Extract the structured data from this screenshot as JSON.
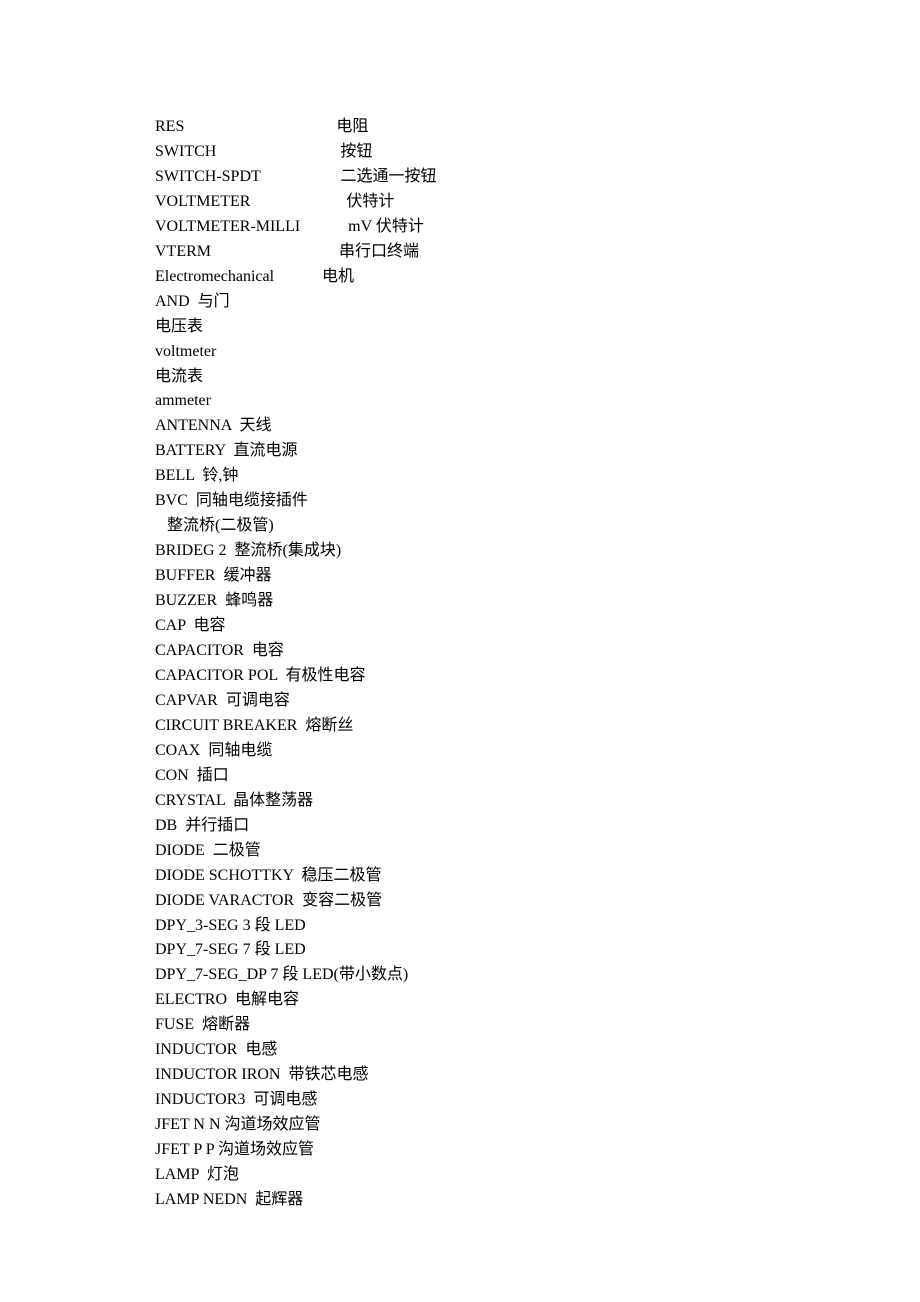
{
  "lines": [
    "RES                                      电阻",
    "SWITCH                               按钮",
    "SWITCH-SPDT                    二选通一按钮",
    "VOLTMETER                        伏特计",
    "VOLTMETER-MILLI            mV 伏特计",
    "VTERM                                串行口终端",
    "Electromechanical            电机",
    "AND  与门",
    "电压表",
    "voltmeter",
    "电流表",
    "ammeter",
    "ANTENNA  天线",
    "BATTERY  直流电源",
    "BELL  铃,钟",
    "BVC  同轴电缆接插件",
    "   整流桥(二极管)",
    "BRIDEG 2  整流桥(集成块)",
    "BUFFER  缓冲器",
    "BUZZER  蜂鸣器",
    "CAP  电容",
    "CAPACITOR  电容",
    "CAPACITOR POL  有极性电容",
    "CAPVAR  可调电容",
    "CIRCUIT BREAKER  熔断丝",
    "COAX  同轴电缆",
    "CON  插口",
    "CRYSTAL  晶体整荡器",
    "DB  并行插口",
    "DIODE  二极管",
    "DIODE SCHOTTKY  稳压二极管",
    "DIODE VARACTOR  变容二极管",
    "DPY_3-SEG 3 段 LED",
    "DPY_7-SEG 7 段 LED",
    "DPY_7-SEG_DP 7 段 LED(带小数点)",
    "ELECTRO  电解电容",
    "FUSE  熔断器",
    "INDUCTOR  电感",
    "INDUCTOR IRON  带铁芯电感",
    "INDUCTOR3  可调电感",
    "JFET N N 沟道场效应管",
    "JFET P P 沟道场效应管",
    "LAMP  灯泡",
    "LAMP NEDN  起辉器"
  ]
}
